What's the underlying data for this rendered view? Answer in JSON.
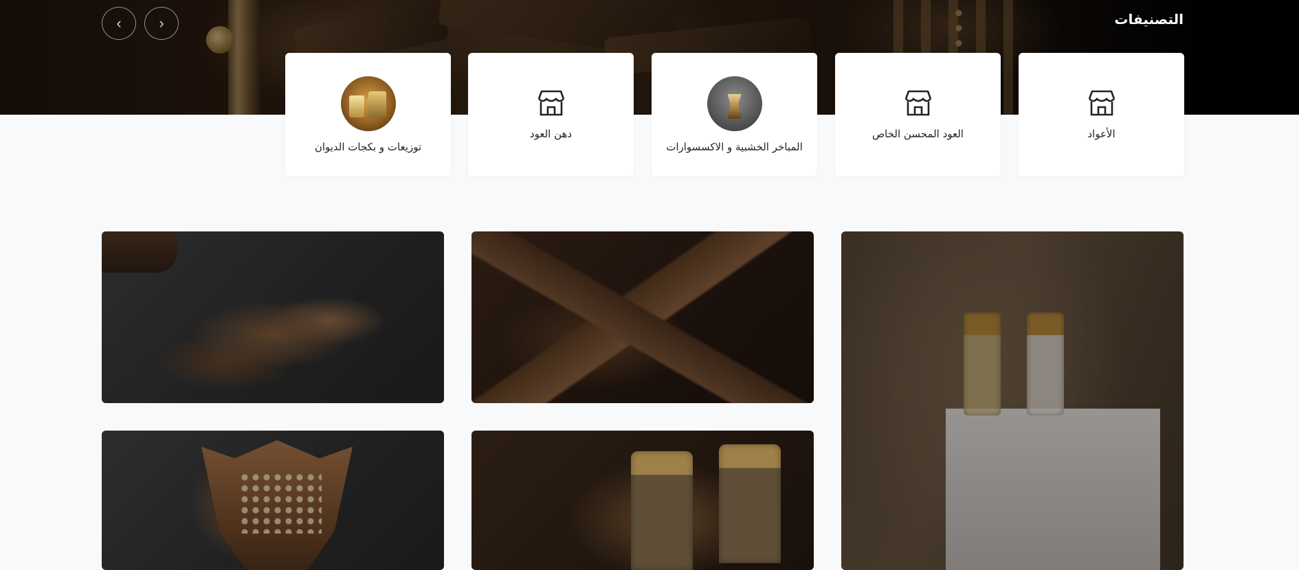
{
  "hero": {
    "title": "التصنيفات",
    "prev_arrow": "‹",
    "next_arrow": "›"
  },
  "categories": [
    {
      "label": "الأعواد",
      "icon": "store-icon"
    },
    {
      "label": "العود المحسن الخاص",
      "icon": "store-icon"
    },
    {
      "label": "المباخر الخشبية و الاكسسوارات",
      "icon": "incense-burner-thumbnail"
    },
    {
      "label": "دهن العود",
      "icon": "store-icon"
    },
    {
      "label": "توزيعات و بكجات الديوان",
      "icon": "gift-package-thumbnail"
    }
  ],
  "tiles": [
    {
      "name": "oud-chips-image"
    },
    {
      "name": "agarwood-pieces-image"
    },
    {
      "name": "oil-bottles-on-box-image"
    },
    {
      "name": "wooden-burner-image"
    },
    {
      "name": "perfume-bottles-image"
    }
  ],
  "colors": {
    "page_background": "#f8f9fb",
    "card_background": "#ffffff",
    "hero_text": "#ffffff"
  }
}
